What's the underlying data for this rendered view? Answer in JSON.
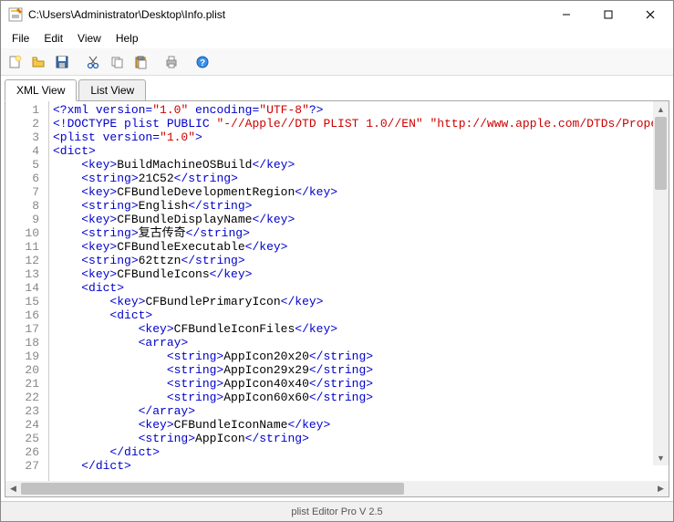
{
  "window": {
    "title": "C:\\Users\\Administrator\\Desktop\\Info.plist"
  },
  "menu": {
    "file": "File",
    "edit": "Edit",
    "view": "View",
    "help": "Help"
  },
  "toolbar": {
    "new": "new-icon",
    "open": "open-icon",
    "save": "save-icon",
    "cut": "cut-icon",
    "copy": "copy-icon",
    "paste": "paste-icon",
    "print": "print-icon",
    "help": "help-icon"
  },
  "tabs": {
    "xml": "XML View",
    "list": "List View"
  },
  "status": {
    "app": "plist Editor Pro V 2.5"
  },
  "code": {
    "lines": [
      {
        "n": 1,
        "indent": 0,
        "tokens": [
          [
            "pi",
            "<?xml "
          ],
          [
            "attr",
            "version="
          ],
          [
            "str",
            "\"1.0\""
          ],
          [
            "attr",
            " encoding="
          ],
          [
            "str",
            "\"UTF-8\""
          ],
          [
            "pi",
            "?>"
          ]
        ]
      },
      {
        "n": 2,
        "indent": 0,
        "tokens": [
          [
            "pi",
            "<!DOCTYPE plist PUBLIC "
          ],
          [
            "str",
            "\"-//Apple//DTD PLIST 1.0//EN\""
          ],
          [
            "pi",
            " "
          ],
          [
            "str",
            "\"http://www.apple.com/DTDs/PropertyLi"
          ]
        ]
      },
      {
        "n": 3,
        "indent": 0,
        "tokens": [
          [
            "tag",
            "<plist "
          ],
          [
            "attr",
            "version="
          ],
          [
            "str",
            "\"1.0\""
          ],
          [
            "tag",
            ">"
          ]
        ]
      },
      {
        "n": 4,
        "indent": 0,
        "tokens": [
          [
            "tag",
            "<dict>"
          ]
        ]
      },
      {
        "n": 5,
        "indent": 1,
        "tokens": [
          [
            "tag",
            "<key>"
          ],
          [
            "txt",
            "BuildMachineOSBuild"
          ],
          [
            "tag",
            "</key>"
          ]
        ]
      },
      {
        "n": 6,
        "indent": 1,
        "tokens": [
          [
            "tag",
            "<string>"
          ],
          [
            "txt",
            "21C52"
          ],
          [
            "tag",
            "</string>"
          ]
        ]
      },
      {
        "n": 7,
        "indent": 1,
        "tokens": [
          [
            "tag",
            "<key>"
          ],
          [
            "txt",
            "CFBundleDevelopmentRegion"
          ],
          [
            "tag",
            "</key>"
          ]
        ]
      },
      {
        "n": 8,
        "indent": 1,
        "tokens": [
          [
            "tag",
            "<string>"
          ],
          [
            "txt",
            "English"
          ],
          [
            "tag",
            "</string>"
          ]
        ]
      },
      {
        "n": 9,
        "indent": 1,
        "tokens": [
          [
            "tag",
            "<key>"
          ],
          [
            "txt",
            "CFBundleDisplayName"
          ],
          [
            "tag",
            "</key>"
          ]
        ]
      },
      {
        "n": 10,
        "indent": 1,
        "tokens": [
          [
            "tag",
            "<string>"
          ],
          [
            "txt",
            "复古传奇"
          ],
          [
            "tag",
            "</string>"
          ]
        ]
      },
      {
        "n": 11,
        "indent": 1,
        "tokens": [
          [
            "tag",
            "<key>"
          ],
          [
            "txt",
            "CFBundleExecutable"
          ],
          [
            "tag",
            "</key>"
          ]
        ]
      },
      {
        "n": 12,
        "indent": 1,
        "tokens": [
          [
            "tag",
            "<string>"
          ],
          [
            "txt",
            "62ttzn"
          ],
          [
            "tag",
            "</string>"
          ]
        ]
      },
      {
        "n": 13,
        "indent": 1,
        "tokens": [
          [
            "tag",
            "<key>"
          ],
          [
            "txt",
            "CFBundleIcons"
          ],
          [
            "tag",
            "</key>"
          ]
        ]
      },
      {
        "n": 14,
        "indent": 1,
        "tokens": [
          [
            "tag",
            "<dict>"
          ]
        ]
      },
      {
        "n": 15,
        "indent": 2,
        "tokens": [
          [
            "tag",
            "<key>"
          ],
          [
            "txt",
            "CFBundlePrimaryIcon"
          ],
          [
            "tag",
            "</key>"
          ]
        ]
      },
      {
        "n": 16,
        "indent": 2,
        "tokens": [
          [
            "tag",
            "<dict>"
          ]
        ]
      },
      {
        "n": 17,
        "indent": 3,
        "tokens": [
          [
            "tag",
            "<key>"
          ],
          [
            "txt",
            "CFBundleIconFiles"
          ],
          [
            "tag",
            "</key>"
          ]
        ]
      },
      {
        "n": 18,
        "indent": 3,
        "tokens": [
          [
            "tag",
            "<array>"
          ]
        ]
      },
      {
        "n": 19,
        "indent": 4,
        "tokens": [
          [
            "tag",
            "<string>"
          ],
          [
            "txt",
            "AppIcon20x20"
          ],
          [
            "tag",
            "</string>"
          ]
        ]
      },
      {
        "n": 20,
        "indent": 4,
        "tokens": [
          [
            "tag",
            "<string>"
          ],
          [
            "txt",
            "AppIcon29x29"
          ],
          [
            "tag",
            "</string>"
          ]
        ]
      },
      {
        "n": 21,
        "indent": 4,
        "tokens": [
          [
            "tag",
            "<string>"
          ],
          [
            "txt",
            "AppIcon40x40"
          ],
          [
            "tag",
            "</string>"
          ]
        ]
      },
      {
        "n": 22,
        "indent": 4,
        "tokens": [
          [
            "tag",
            "<string>"
          ],
          [
            "txt",
            "AppIcon60x60"
          ],
          [
            "tag",
            "</string>"
          ]
        ]
      },
      {
        "n": 23,
        "indent": 3,
        "tokens": [
          [
            "tag",
            "</array>"
          ]
        ]
      },
      {
        "n": 24,
        "indent": 3,
        "tokens": [
          [
            "tag",
            "<key>"
          ],
          [
            "txt",
            "CFBundleIconName"
          ],
          [
            "tag",
            "</key>"
          ]
        ]
      },
      {
        "n": 25,
        "indent": 3,
        "tokens": [
          [
            "tag",
            "<string>"
          ],
          [
            "txt",
            "AppIcon"
          ],
          [
            "tag",
            "</string>"
          ]
        ]
      },
      {
        "n": 26,
        "indent": 2,
        "tokens": [
          [
            "tag",
            "</dict>"
          ]
        ]
      },
      {
        "n": 27,
        "indent": 1,
        "tokens": [
          [
            "tag",
            "</dict>"
          ]
        ]
      }
    ]
  }
}
